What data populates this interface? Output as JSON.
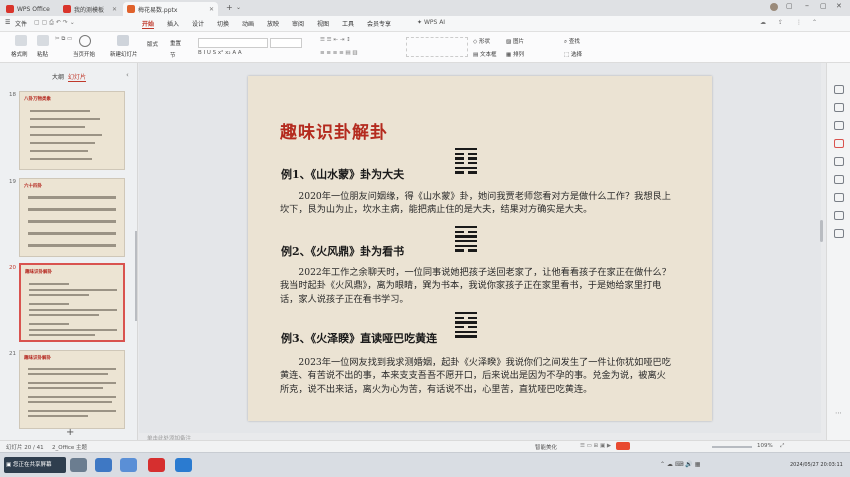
{
  "tabs": [
    {
      "label": "WPS Office"
    },
    {
      "label": "我的测模板"
    },
    {
      "label": "梅花易数.pptx"
    }
  ],
  "menu": {
    "file": "文件",
    "items": [
      "开始",
      "插入",
      "设计",
      "切换",
      "动画",
      "放映",
      "审阅",
      "视图",
      "工具",
      "会员专享"
    ],
    "ai": "WPS AI"
  },
  "ribbon": {
    "format_painter": "格式刷",
    "paste": "粘贴",
    "play_from_current": "当页开始",
    "new_slide": "新建幻灯片",
    "layout": "版式",
    "section": "节",
    "reset": "重置",
    "shape": "形状",
    "picture": "图片",
    "textbox": "文本框",
    "arrange": "排列",
    "find": "查找",
    "select": "选择"
  },
  "panel": {
    "outline_tab": "大纲",
    "slides_tab": "幻灯片",
    "add": "+"
  },
  "thumbs": [
    {
      "num": "18",
      "title": "八卦万物类象"
    },
    {
      "num": "19",
      "title": "六十四卦"
    },
    {
      "num": "20",
      "title": "趣味识卦解卦"
    },
    {
      "num": "21",
      "title": "趣味识卦解卦"
    }
  ],
  "slide": {
    "title": "趣味识卦解卦",
    "examples": [
      {
        "heading": "例1、《山水蒙》卦为大夫",
        "text": "2020年一位朋友问姻缘，得《山水蒙》卦，她问我贾老师您看对方是做什么工作？我想艮上坎下，艮为山为止，坎水主病，能把病止住的是大夫，结果对方确实是大夫。"
      },
      {
        "heading": "例2、《火风鼎》卦为看书",
        "text": "2022年工作之余聊天时，一位同事说她把孩子送回老家了，让他看看孩子在家正在做什么？我当时起卦《火风鼎》，离为眼睛，巽为书本，我说你家孩子正在家里看书，于是她给家里打电话，家人说孩子正在看书学习。"
      },
      {
        "heading": "例3、《火泽睽》直读哑巴吃黄连",
        "text": "2023年一位网友找到我求测婚姻，起卦《火泽睽》我说你们之间发生了一件让你犹如哑巴吃黄连、有苦说不出的事，本来支支吾吾不愿开口，后来说出是因为不孕的事。兑金为说，被离火所克，说不出来话，离火为心为苦，有话说不出，心里苦，直犹哑巴吃黄连。"
      }
    ]
  },
  "notes_placeholder": "单击此处添加备注",
  "status": {
    "slide_count": "幻灯片 20 / 41",
    "theme": "2_Office 主题",
    "smart_beautify": "智能美化",
    "zoom": "109%"
  },
  "taskbar": {
    "shared_screen": "您正在共享屏幕",
    "clock": "2024/05/27 20:03:11"
  }
}
